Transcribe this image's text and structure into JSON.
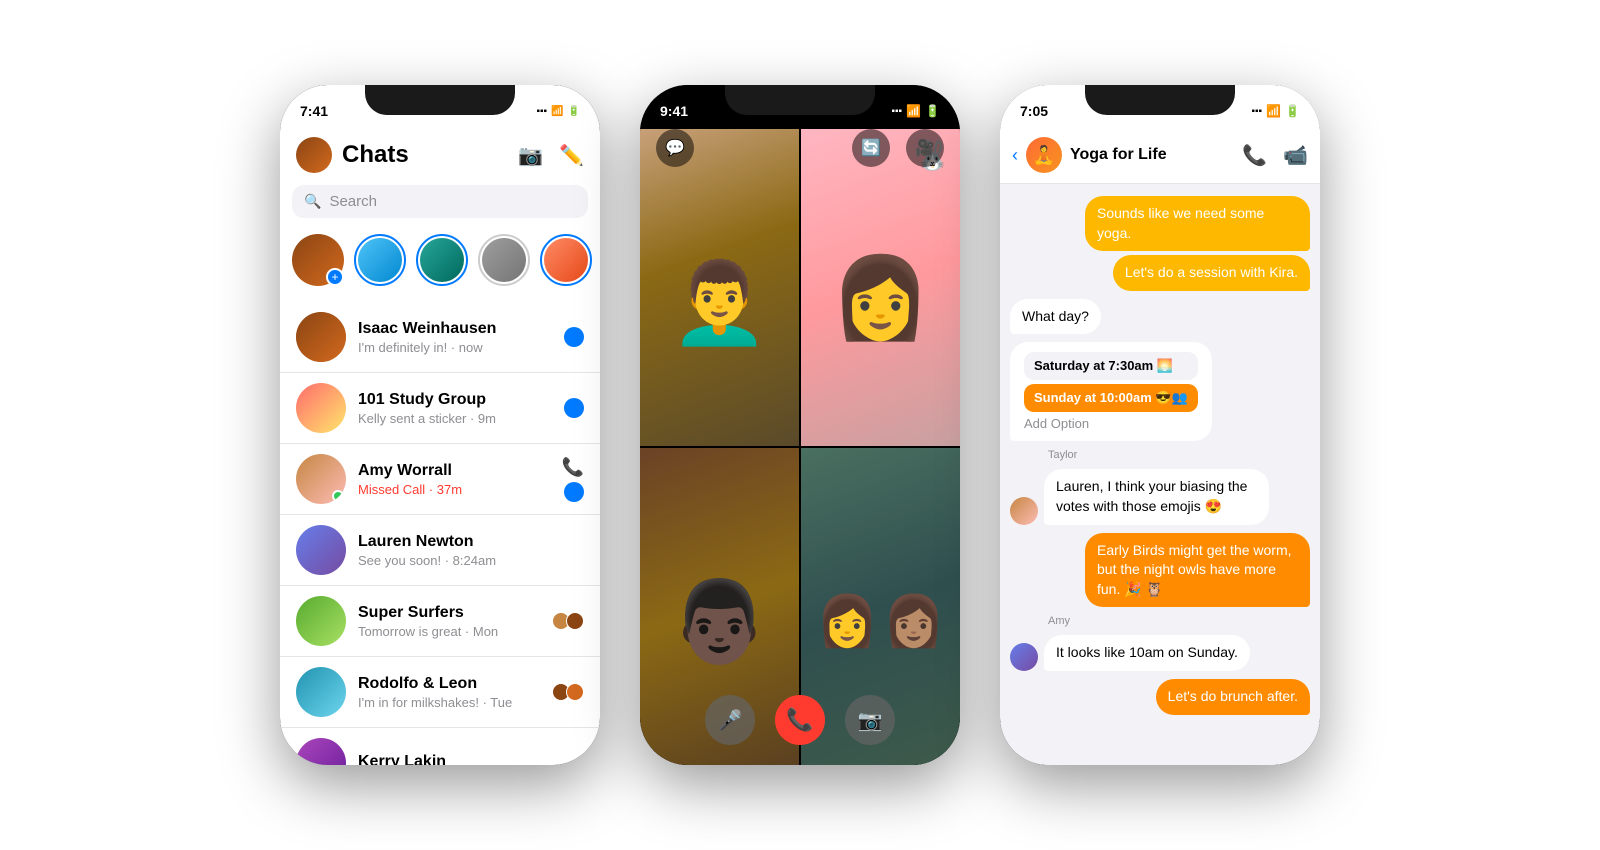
{
  "phone1": {
    "status_time": "7:41",
    "title": "Chats",
    "search_placeholder": "Search",
    "chats": [
      {
        "name": "Isaac Weinhausen",
        "preview": "I'm definitely in!",
        "time": "now",
        "unread": true,
        "missed_call": false,
        "group": false
      },
      {
        "name": "101 Study Group",
        "preview": "Kelly sent a sticker",
        "time": "9m",
        "unread": true,
        "missed_call": false,
        "group": true
      },
      {
        "name": "Amy Worrall",
        "preview": "Missed Call",
        "time": "37m",
        "unread": true,
        "missed_call": true,
        "group": false
      },
      {
        "name": "Lauren Newton",
        "preview": "See you soon!",
        "time": "8:24am",
        "unread": false,
        "missed_call": false,
        "group": false
      },
      {
        "name": "Super Surfers",
        "preview": "Tomorrow is great",
        "time": "Mon",
        "unread": false,
        "missed_call": false,
        "group": true
      },
      {
        "name": "Rodolfo & Leon",
        "preview": "I'm in for milkshakes!",
        "time": "Tue",
        "unread": false,
        "missed_call": false,
        "group": true
      },
      {
        "name": "Kerry Lakin",
        "preview": "",
        "time": "",
        "unread": false,
        "missed_call": false,
        "group": false
      }
    ]
  },
  "phone2": {
    "status_time": "9:41",
    "call_type": "Group FaceTime"
  },
  "phone3": {
    "status_time": "7:05",
    "group_name": "Yoga for Life",
    "messages": [
      {
        "text": "Sounds like we need some yoga.",
        "sender": "out",
        "type": "bubble"
      },
      {
        "text": "Let's do a session with Kira.",
        "sender": "out",
        "type": "bubble"
      },
      {
        "text": "What day?",
        "sender": "in",
        "type": "bubble"
      },
      {
        "text": "Saturday at 7:30am 🌅",
        "sender": "in",
        "type": "poll-option-normal"
      },
      {
        "text": "Sunday at 10:00am 😎",
        "sender": "in-orange",
        "type": "poll-option-selected"
      },
      {
        "text": "Add Option",
        "sender": "in",
        "type": "poll-add"
      },
      {
        "label": "Taylor",
        "text": "Lauren, I think your biasing the votes with those emojis 😍",
        "sender": "in",
        "type": "with-avatar"
      },
      {
        "text": "Early Birds might get the worm, but the night owls have more fun. 🎉 🦉",
        "sender": "out",
        "type": "bubble"
      },
      {
        "label": "Amy",
        "text": "It looks like 10am on Sunday.",
        "sender": "in",
        "type": "with-avatar"
      },
      {
        "text": "Let's do brunch after.",
        "sender": "out",
        "type": "bubble"
      }
    ]
  }
}
